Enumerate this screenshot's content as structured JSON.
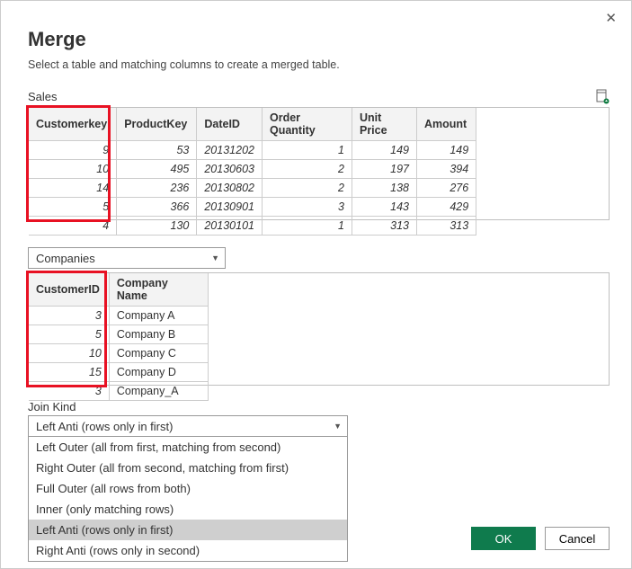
{
  "dialog": {
    "title": "Merge",
    "subtitle": "Select a table and matching columns to create a merged table."
  },
  "table1": {
    "label": "Sales",
    "headers": [
      "Customerkey",
      "ProductKey",
      "DateID",
      "Order Quantity",
      "Unit Price",
      "Amount"
    ],
    "rows": [
      {
        "c0": "9",
        "c1": "53",
        "c2": "20131202",
        "c3": "1",
        "c4": "149",
        "c5": "149"
      },
      {
        "c0": "10",
        "c1": "495",
        "c2": "20130603",
        "c3": "2",
        "c4": "197",
        "c5": "394"
      },
      {
        "c0": "14",
        "c1": "236",
        "c2": "20130802",
        "c3": "2",
        "c4": "138",
        "c5": "276"
      },
      {
        "c0": "5",
        "c1": "366",
        "c2": "20130901",
        "c3": "3",
        "c4": "143",
        "c5": "429"
      },
      {
        "c0": "4",
        "c1": "130",
        "c2": "20130101",
        "c3": "1",
        "c4": "313",
        "c5": "313"
      }
    ]
  },
  "table2": {
    "select_label": "Companies",
    "headers": [
      "CustomerID",
      "Company Name"
    ],
    "rows": [
      {
        "c0": "3",
        "c1": "Company A"
      },
      {
        "c0": "5",
        "c1": "Company B"
      },
      {
        "c0": "10",
        "c1": "Company C"
      },
      {
        "c0": "15",
        "c1": "Company D"
      },
      {
        "c0": "3",
        "c1": "Company_A"
      }
    ]
  },
  "join": {
    "label": "Join Kind",
    "selected": "Left Anti (rows only in first)",
    "options": [
      "Left Outer (all from first, matching from second)",
      "Right Outer (all from second, matching from first)",
      "Full Outer (all rows from both)",
      "Inner (only matching rows)",
      "Left Anti (rows only in first)",
      "Right Anti (rows only in second)"
    ],
    "selected_index": 4
  },
  "buttons": {
    "ok": "OK",
    "cancel": "Cancel"
  }
}
